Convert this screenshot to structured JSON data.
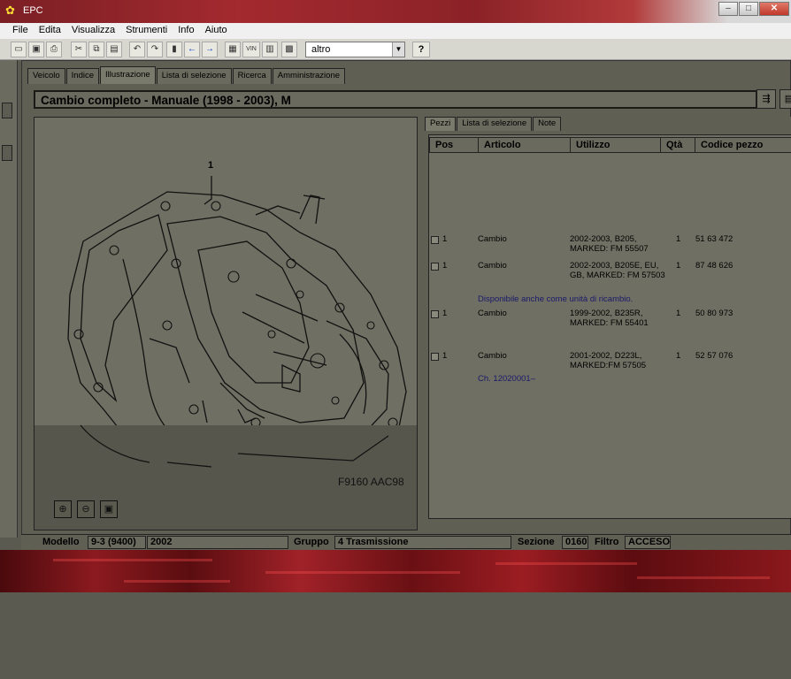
{
  "window": {
    "title": "EPC",
    "min": "–",
    "max": "□",
    "close": "✕"
  },
  "menu": [
    "File",
    "Edita",
    "Visualizza",
    "Strumenti",
    "Info",
    "Aiuto"
  ],
  "toolbar": {
    "vin_label": "VIN",
    "language": "altro",
    "help_label": "?"
  },
  "tabs": [
    "Veicolo",
    "Indice",
    "Illustrazione",
    "Lista di selezione",
    "Ricerca",
    "Amministrazione"
  ],
  "active_tab": "Illustrazione",
  "doc_title": "Cambio completo - Manuale   (1998 - 2003), M",
  "illustration": {
    "item_number": "1",
    "figure_code": "F9160 AAC98"
  },
  "right_tabs": [
    "Pezzi",
    "Lista di selezione",
    "Note"
  ],
  "parts_table": {
    "headers": [
      "Pos",
      "Articolo",
      "Utilizzo",
      "Qtà",
      "Codice pezzo"
    ],
    "rows": [
      {
        "pos": "1",
        "articolo": "Cambio",
        "utilizzo": "2002-2003, B205, MARKED: FM 55507",
        "qta": "1",
        "codice": "51 63 472"
      },
      {
        "pos": "1",
        "articolo": "Cambio",
        "utilizzo": "2002-2003, B205E, EU, GB, MARKED: FM 57503",
        "qta": "1",
        "codice": "87 48 626"
      },
      {
        "pos": "1",
        "articolo": "Cambio",
        "utilizzo": "1999-2002, B235R, MARKED: FM 55401",
        "qta": "1",
        "codice": "50 80 973"
      },
      {
        "pos": "1",
        "articolo": "Cambio",
        "utilizzo": "2001-2002, D223L, MARKED:FM 57505",
        "qta": "1",
        "codice": "52 57 076"
      }
    ],
    "note_1": "Disponibile anche come unità di ricambio.",
    "note_2": "Ch. 12020001–"
  },
  "statusbar": {
    "model_label": "Modello",
    "model_value": "9-3 (9400)",
    "year_value": "2002",
    "group_label": "Gruppo",
    "group_value": "4 Trasmissione",
    "section_label": "Sezione",
    "section_value": "0160",
    "filter_label": "Filtro",
    "filter_value": "ACCESO"
  },
  "icons": [
    "app-logo-icon",
    "new-icon",
    "save-icon",
    "print-icon",
    "cut-icon",
    "copy-icon",
    "paste-icon",
    "undo-icon",
    "redo-icon",
    "back-arrow-icon",
    "forward-arrow-icon",
    "zoom-in-icon",
    "zoom-out-icon",
    "fit-icon"
  ]
}
